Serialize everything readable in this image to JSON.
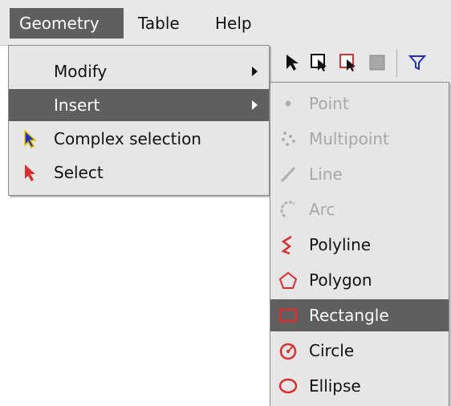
{
  "menubar": {
    "items": [
      {
        "label": "Geometry"
      },
      {
        "label": "Table"
      },
      {
        "label": "Help"
      }
    ]
  },
  "geometry_menu": {
    "items": [
      {
        "label": "Modify",
        "submenu": true
      },
      {
        "label": "Insert",
        "submenu": true,
        "selected": true
      },
      {
        "label": "Complex selection",
        "icon": "blue-pointer-icon"
      },
      {
        "label": "Select",
        "icon": "red-pointer-icon"
      }
    ]
  },
  "insert_submenu": {
    "items": [
      {
        "label": "Point",
        "icon": "point-icon",
        "enabled": false
      },
      {
        "label": "Multipoint",
        "icon": "multipoint-icon",
        "enabled": false
      },
      {
        "label": "Line",
        "icon": "line-icon",
        "enabled": false
      },
      {
        "label": "Arc",
        "icon": "arc-icon",
        "enabled": false
      },
      {
        "label": "Polyline",
        "icon": "polyline-icon",
        "enabled": true
      },
      {
        "label": "Polygon",
        "icon": "polygon-icon",
        "enabled": true
      },
      {
        "label": "Rectangle",
        "icon": "rectangle-icon",
        "enabled": true,
        "selected": true
      },
      {
        "label": "Circle",
        "icon": "circle-icon",
        "enabled": true
      },
      {
        "label": "Ellipse",
        "icon": "ellipse-icon",
        "enabled": true
      }
    ]
  },
  "toolbar": {
    "icons": [
      "pointer-icon",
      "select-box-icon",
      "select-rect-icon",
      "gray-square-icon",
      "filter-icon"
    ]
  },
  "colors": {
    "menu_bg": "#e6e6e6",
    "selected_bg": "#5f5f5f",
    "disabled_text": "#a8a8a8",
    "icon_red": "#d83030",
    "icon_blue": "#2030c0"
  }
}
